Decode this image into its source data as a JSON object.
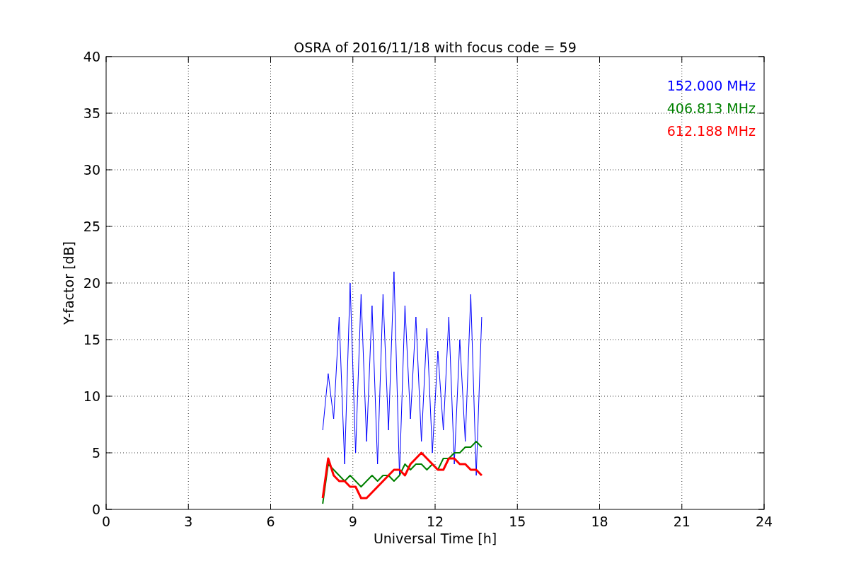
{
  "chart_data": {
    "type": "line",
    "title": "OSRA of 2016/11/18 with focus code = 59",
    "xlabel": "Universal Time [h]",
    "ylabel": "Y-factor [dB]",
    "x": [
      7.9,
      8.1,
      8.3,
      8.5,
      8.7,
      8.9,
      9.1,
      9.3,
      9.5,
      9.7,
      9.9,
      10.1,
      10.3,
      10.5,
      10.7,
      10.9,
      11.1,
      11.3,
      11.5,
      11.7,
      11.9,
      12.1,
      12.3,
      12.5,
      12.7,
      12.9,
      13.1,
      13.3,
      13.5,
      13.7
    ],
    "series": [
      {
        "name": "152.000 MHz",
        "color": "#0000ff",
        "values": [
          7,
          12,
          8,
          17,
          4,
          20,
          5,
          19,
          6,
          18,
          4,
          19,
          7,
          21,
          3,
          18,
          8,
          17,
          6,
          16,
          5,
          14,
          7,
          17,
          4,
          15,
          6,
          19,
          3,
          17
        ]
      },
      {
        "name": "406.813 MHz",
        "color": "#008000",
        "values": [
          0.5,
          4,
          3.5,
          3,
          2.5,
          3,
          2.5,
          2,
          2.5,
          3,
          2.5,
          3,
          3,
          2.5,
          3,
          4,
          3.5,
          4,
          4,
          3.5,
          4,
          3.5,
          4.5,
          4.5,
          5,
          5,
          5.5,
          5.5,
          6,
          5.5
        ]
      },
      {
        "name": "612.188 MHz",
        "color": "#ff0000",
        "values": [
          1,
          4.5,
          3,
          2.5,
          2.5,
          2,
          2,
          1,
          1,
          1.5,
          2,
          2.5,
          3,
          3.5,
          3.5,
          3,
          4,
          4.5,
          5,
          4.5,
          4,
          3.5,
          3.5,
          4.5,
          4.5,
          4,
          4,
          3.5,
          3.5,
          3
        ]
      }
    ],
    "grid": true,
    "xlim": [
      0,
      24
    ],
    "ylim": [
      0,
      40
    ],
    "xticks": [
      0,
      3,
      6,
      9,
      12,
      15,
      18,
      21,
      24
    ],
    "yticks": [
      0,
      5,
      10,
      15,
      20,
      25,
      30,
      35,
      40
    ]
  }
}
